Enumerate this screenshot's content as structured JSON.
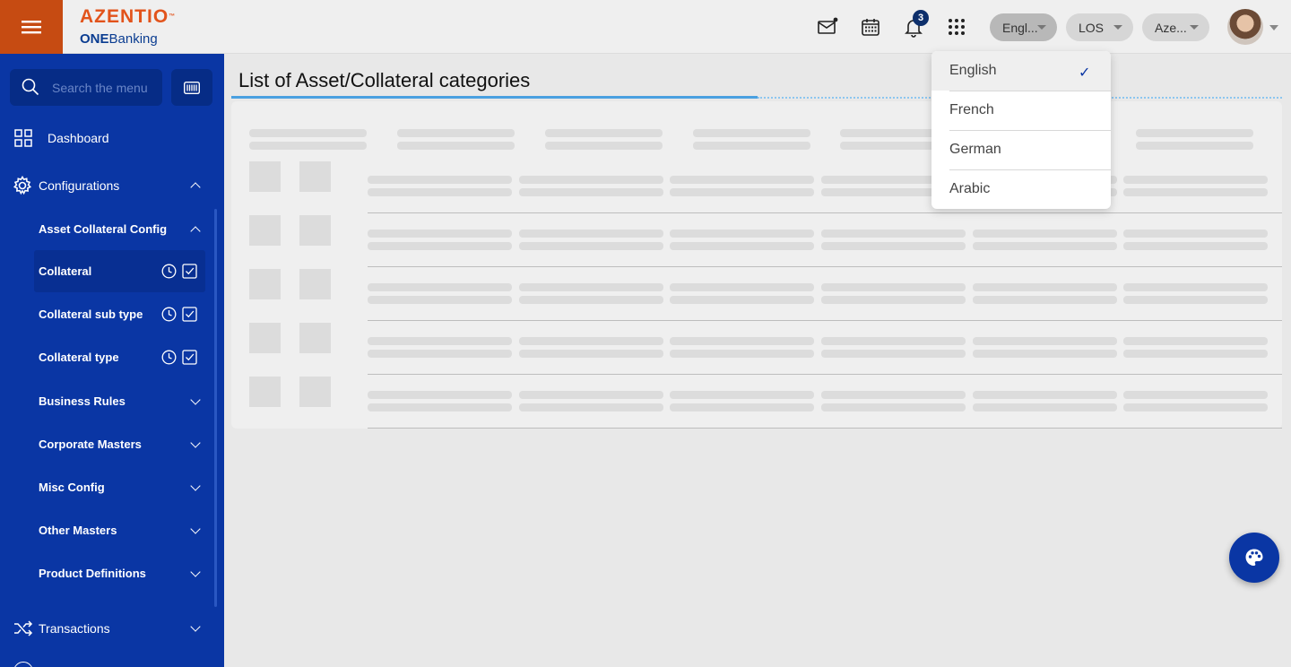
{
  "header": {
    "logo_brand": "AZENTIO",
    "logo_tm": "™",
    "logo_sub_bold": "ONE",
    "logo_sub": "Banking",
    "notification_count": "3",
    "language_label": "Engl...",
    "module_label": "LOS",
    "entity_label": "Aze..."
  },
  "sidebar": {
    "search_placeholder": "Search the menu",
    "items": [
      {
        "label": "Dashboard",
        "icon": "grid-icon"
      },
      {
        "label": "Configurations",
        "icon": "gear-icon",
        "expanded": true
      },
      {
        "label": "Asset Collateral Config",
        "expanded": true
      },
      {
        "label": "Collateral",
        "active": true
      },
      {
        "label": "Collateral sub type"
      },
      {
        "label": "Collateral type"
      },
      {
        "label": "Business Rules"
      },
      {
        "label": "Corporate Masters"
      },
      {
        "label": "Misc Config"
      },
      {
        "label": "Other Masters"
      },
      {
        "label": "Product Definitions"
      },
      {
        "label": "Transactions",
        "icon": "shuffle-icon"
      }
    ]
  },
  "main": {
    "title": "List of Asset/Collateral categories"
  },
  "language_menu": {
    "options": [
      "English",
      "French",
      "German",
      "Arabic"
    ],
    "selected": "English",
    "check": "✓"
  },
  "colors": {
    "brand": "#e2531b",
    "sidebar": "#0a36a4",
    "accent": "#4aa0e0"
  }
}
